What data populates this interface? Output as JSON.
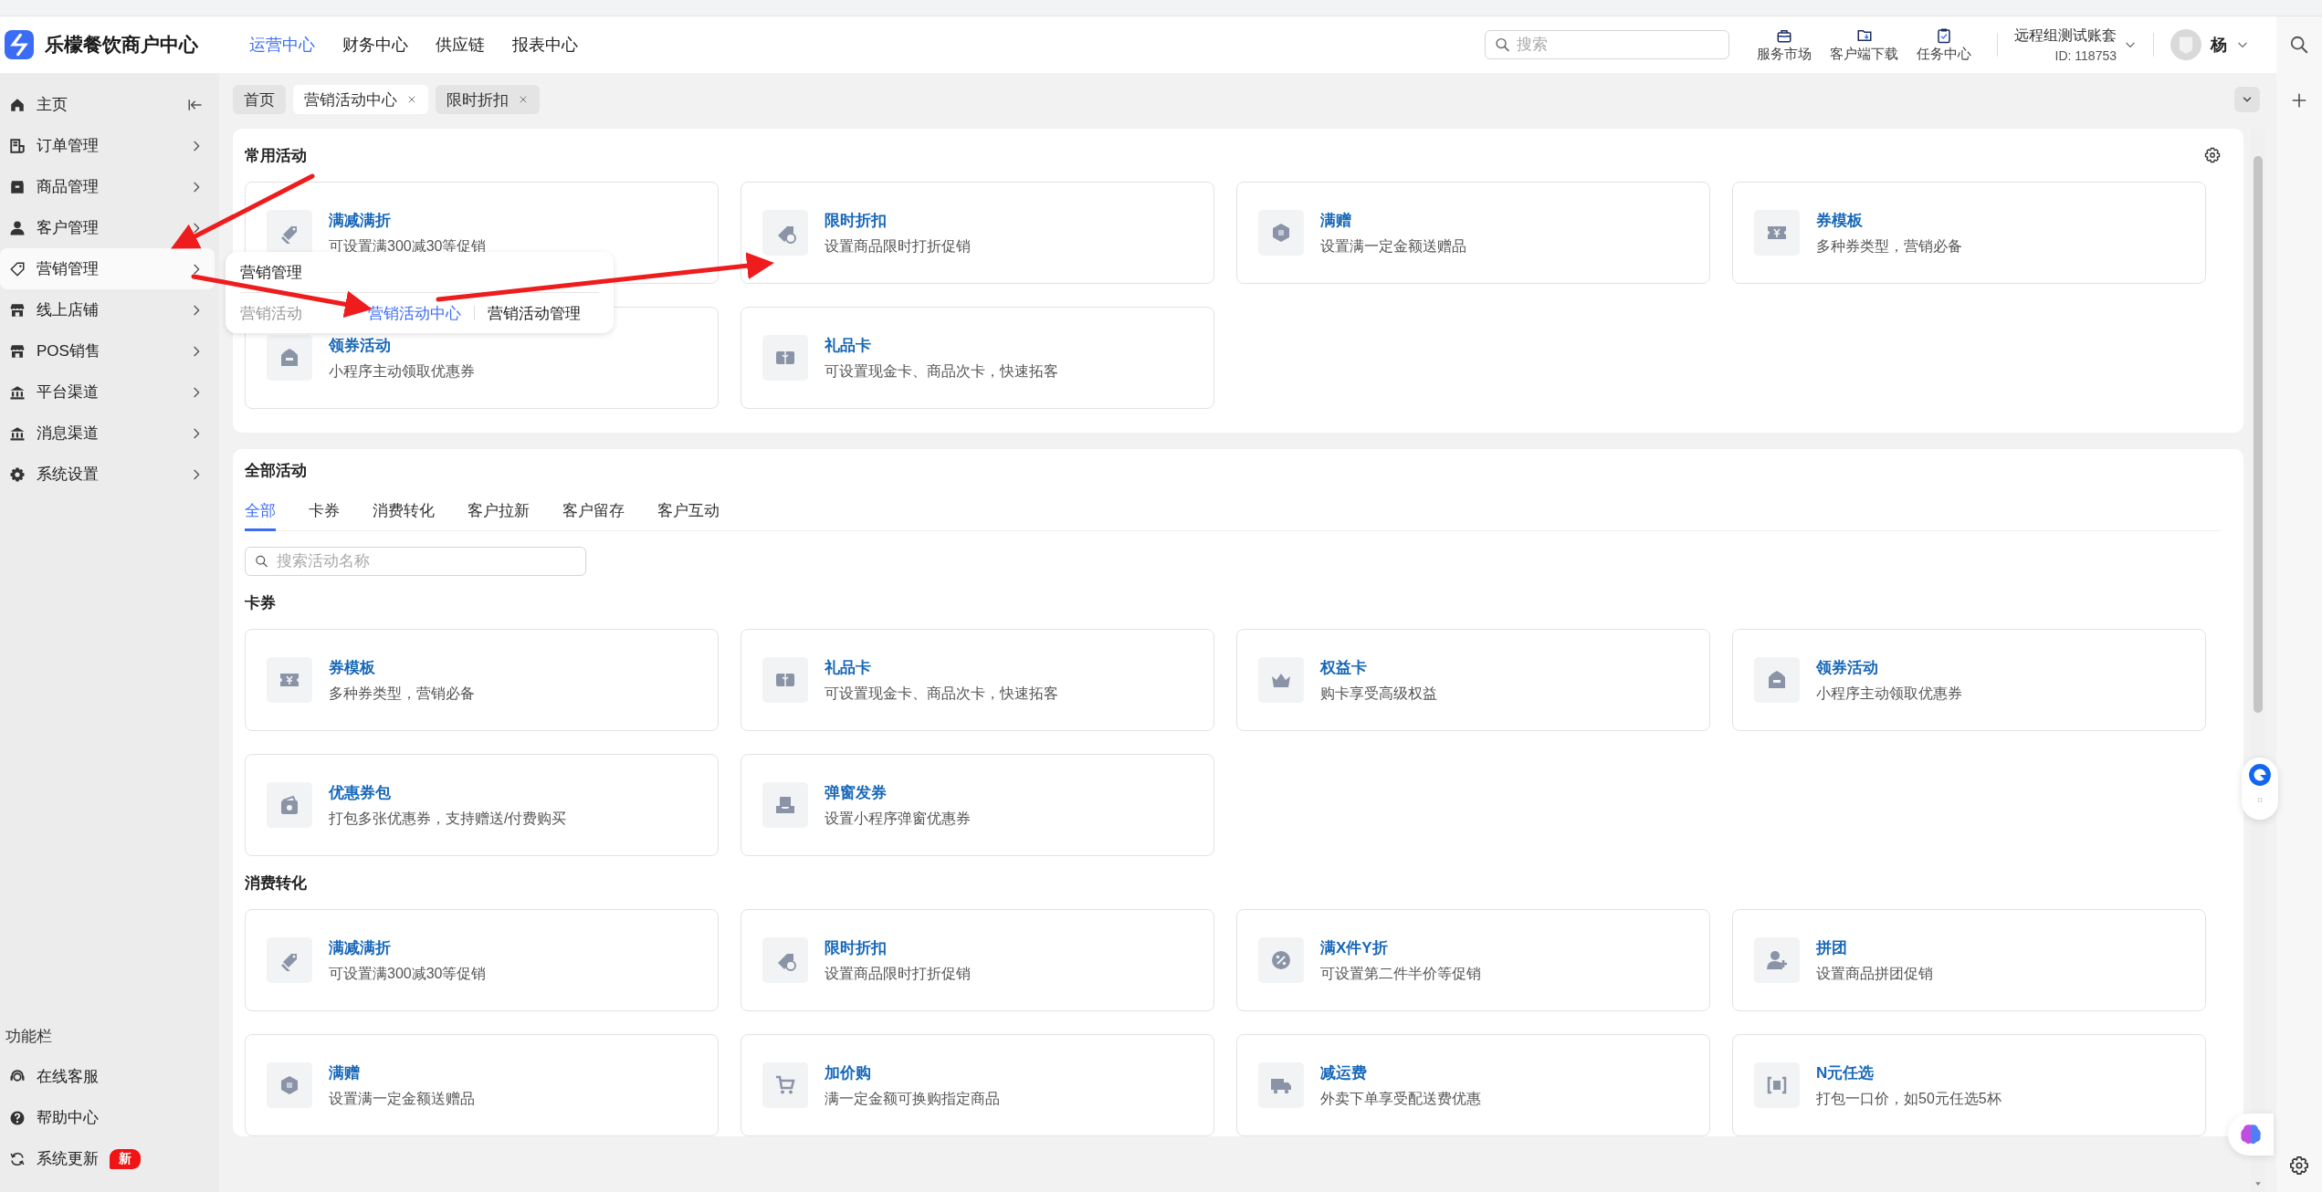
{
  "header": {
    "logo_text": "乐檬餐饮商户中心",
    "nav": [
      {
        "label": "运营中心",
        "selected": true
      },
      {
        "label": "财务中心",
        "selected": false
      },
      {
        "label": "供应链",
        "selected": false
      },
      {
        "label": "报表中心",
        "selected": false
      }
    ],
    "search": {
      "placeholder": "搜索"
    },
    "tools": [
      {
        "label": "服务市场",
        "kind": "bag"
      },
      {
        "label": "客户端下载",
        "kind": "folder"
      },
      {
        "label": "任务中心",
        "kind": "clipboard"
      }
    ],
    "account": {
      "name": "远程组测试账套",
      "id": "ID: 118753"
    },
    "user": {
      "name": "杨"
    }
  },
  "sidebar": {
    "items": [
      {
        "label": "主页",
        "kind": "home",
        "selected": false,
        "expandable": false
      },
      {
        "label": "订单管理",
        "kind": "receipt",
        "selected": false,
        "expandable": true
      },
      {
        "label": "商品管理",
        "kind": "box",
        "selected": false,
        "expandable": true
      },
      {
        "label": "客户管理",
        "kind": "person",
        "selected": false,
        "expandable": true
      },
      {
        "label": "营销管理",
        "kind": "tag",
        "selected": true,
        "expandable": true
      },
      {
        "label": "线上店铺",
        "kind": "shop",
        "selected": false,
        "expandable": true
      },
      {
        "label": "POS销售",
        "kind": "shop",
        "selected": false,
        "expandable": true
      },
      {
        "label": "平台渠道",
        "kind": "bank",
        "selected": false,
        "expandable": true
      },
      {
        "label": "消息渠道",
        "kind": "bank",
        "selected": false,
        "expandable": true
      },
      {
        "label": "系统设置",
        "kind": "gear",
        "selected": false,
        "expandable": true
      }
    ],
    "footer_title": "功能栏",
    "footer_items": [
      {
        "label": "在线客服",
        "kind": "headset"
      },
      {
        "label": "帮助中心",
        "kind": "help"
      },
      {
        "label": "系统更新",
        "kind": "refresh",
        "badge": "新"
      }
    ]
  },
  "page_tabs": [
    {
      "label": "首页",
      "selected": false,
      "closable": false
    },
    {
      "label": "营销活动中心",
      "selected": true,
      "closable": true
    },
    {
      "label": "限时折扣",
      "selected": false,
      "closable": true
    }
  ],
  "flyout": {
    "title": "营销管理",
    "group": "营销活动",
    "links": [
      {
        "label": "营销活动中心",
        "selected": true
      },
      {
        "label": "营销活动管理",
        "selected": false
      }
    ]
  },
  "common": {
    "title": "常用活动",
    "cards": [
      {
        "title": "满减满折",
        "desc": "可设置满300减30等促销",
        "kind": "tags"
      },
      {
        "title": "限时折扣",
        "desc": "设置商品限时打折促销",
        "kind": "clock-tag"
      },
      {
        "title": "满赠",
        "desc": "设置满一定金额送赠品",
        "kind": "hexagon"
      },
      {
        "title": "券模板",
        "desc": "多种券类型，营销必备",
        "kind": "ticket"
      },
      {
        "title": "领券活动",
        "desc": "小程序主动领取优惠券",
        "kind": "bag"
      },
      {
        "title": "礼品卡",
        "desc": "可设置现金卡、商品次卡，快速拓客",
        "kind": "gift"
      }
    ]
  },
  "all": {
    "title": "全部活动",
    "tabs": [
      {
        "label": "全部",
        "selected": true
      },
      {
        "label": "卡券",
        "selected": false
      },
      {
        "label": "消费转化",
        "selected": false
      },
      {
        "label": "客户拉新",
        "selected": false
      },
      {
        "label": "客户留存",
        "selected": false
      },
      {
        "label": "客户互动",
        "selected": false
      }
    ],
    "search": {
      "placeholder": "搜索活动名称"
    },
    "groups": [
      {
        "title": "卡券",
        "cards": [
          {
            "title": "券模板",
            "desc": "多种券类型，营销必备",
            "kind": "ticket"
          },
          {
            "title": "礼品卡",
            "desc": "可设置现金卡、商品次卡，快速拓客",
            "kind": "gift"
          },
          {
            "title": "权益卡",
            "desc": "购卡享受高级权益",
            "kind": "crown"
          },
          {
            "title": "领券活动",
            "desc": "小程序主动领取优惠券",
            "kind": "bag"
          },
          {
            "title": "优惠券包",
            "desc": "打包多张优惠券，支持赠送/付费购买",
            "kind": "wallet"
          },
          {
            "title": "弹窗发券",
            "desc": "设置小程序弹窗优惠券",
            "kind": "tray"
          }
        ]
      },
      {
        "title": "消费转化",
        "cards": [
          {
            "title": "满减满折",
            "desc": "可设置满300减30等促销",
            "kind": "tags"
          },
          {
            "title": "限时折扣",
            "desc": "设置商品限时打折促销",
            "kind": "clock-tag"
          },
          {
            "title": "满X件Y折",
            "desc": "可设置第二件半价等促销",
            "kind": "percent"
          },
          {
            "title": "拼团",
            "desc": "设置商品拼团促销",
            "kind": "people"
          },
          {
            "title": "满赠",
            "desc": "设置满一定金额送赠品",
            "kind": "hexagon"
          },
          {
            "title": "加价购",
            "desc": "满一定金额可换购指定商品",
            "kind": "cart"
          },
          {
            "title": "减运费",
            "desc": "外卖下单享受配送费优惠",
            "kind": "truck"
          },
          {
            "title": "N元任选",
            "desc": "打包一口价，如50元任选5杯",
            "kind": "bracket"
          }
        ]
      }
    ]
  }
}
